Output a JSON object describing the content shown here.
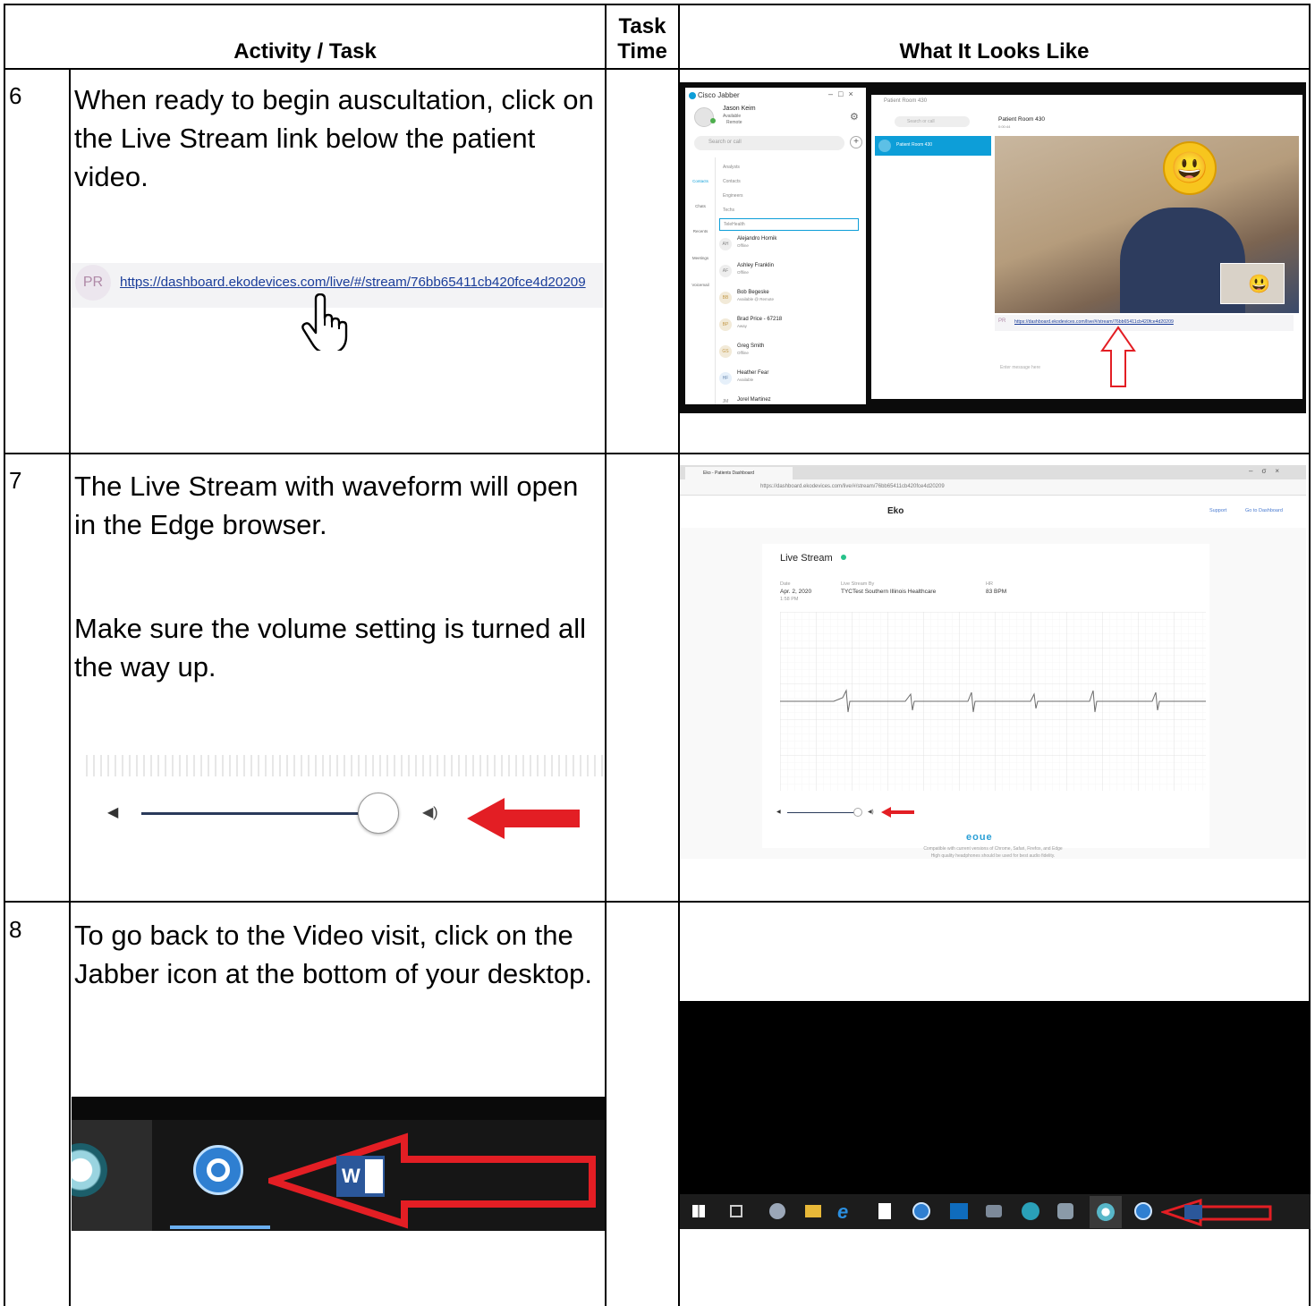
{
  "header": {
    "activity": "Activity / Task",
    "time_line1": "Task",
    "time_line2": "Time",
    "looks": "What It Looks Like"
  },
  "rows": [
    {
      "num": "6",
      "text": "When ready to begin auscultation, click on the Live Stream link below the patient video.",
      "link_badge": "PR",
      "link_url": "https://dashboard.ekodevices.com/live/#/stream/76bb65411cb420fce4d20209"
    },
    {
      "num": "7",
      "text1": "The Live Stream with waveform will open in the Edge browser.",
      "text2": "Make sure the volume setting is turned all the way up."
    },
    {
      "num": "8",
      "text": "To go back to the Video visit, click on the Jabber icon at the bottom of your desktop."
    }
  ],
  "jabber": {
    "app_title": "Cisco Jabber",
    "user_name": "Jason Keim",
    "user_status": "Available",
    "user_location": "Remote",
    "search_placeholder": "Search or call",
    "nav": [
      "Contacts",
      "Chats",
      "Recents",
      "Meetings",
      "Voicemail"
    ],
    "groups": [
      "Analysts",
      "Contacts",
      "Engineers",
      "Techs",
      "TeleHealth"
    ],
    "contacts": [
      {
        "initials": "AH",
        "name": "Alejandro Hornik",
        "status": "Offline"
      },
      {
        "initials": "AF",
        "name": "Ashley Franklin",
        "status": "Offline"
      },
      {
        "initials": "BB",
        "name": "Bob Begeske",
        "status": "Available @ Remote"
      },
      {
        "initials": "BP",
        "name": "Brad Price - 67218",
        "status": "Away"
      },
      {
        "initials": "GS",
        "name": "Greg Smith",
        "status": "Offline"
      },
      {
        "initials": "HF",
        "name": "Heather Fear",
        "status": "Available"
      },
      {
        "initials": "JM",
        "name": "Jorel Martinez",
        "status": ""
      }
    ],
    "room_window_title": "Patient Room 430",
    "room_search": "Search or call",
    "room_name": "Patient Room 430",
    "room_time": "0:00:44",
    "room_item": "Patient Room 430",
    "message_placeholder": "Enter message here"
  },
  "eko": {
    "tab_title": "Eko - Patients Dashboard",
    "address": "https://dashboard.ekodevices.com/live/#/stream/76bb65411cb420fce4d20209",
    "brand": "Eko",
    "support": "Support",
    "dashboard": "Go to Dashboard",
    "live_stream": "Live Stream",
    "date_label": "Date",
    "date_value": "Apr. 2, 2020",
    "time_value": "1:58 PM",
    "by_label": "Live Stream By",
    "by_value": "TYCTest Southern Illinois Healthcare",
    "hr_label": "HR",
    "hr_value": "83 BPM",
    "footer_logo": "eoue",
    "footer1": "Compatible with current versions of Chrome, Safari, Firefox, and Edge",
    "footer2": "High quality headphones should be used for best audio fidelity."
  },
  "taskbar": {
    "word_label": "W"
  },
  "colors": {
    "arrow_red": "#e31e24",
    "link_blue": "#1a3d9a",
    "jabber_blue": "#0d9ed8",
    "eko_green": "#27c28a"
  }
}
